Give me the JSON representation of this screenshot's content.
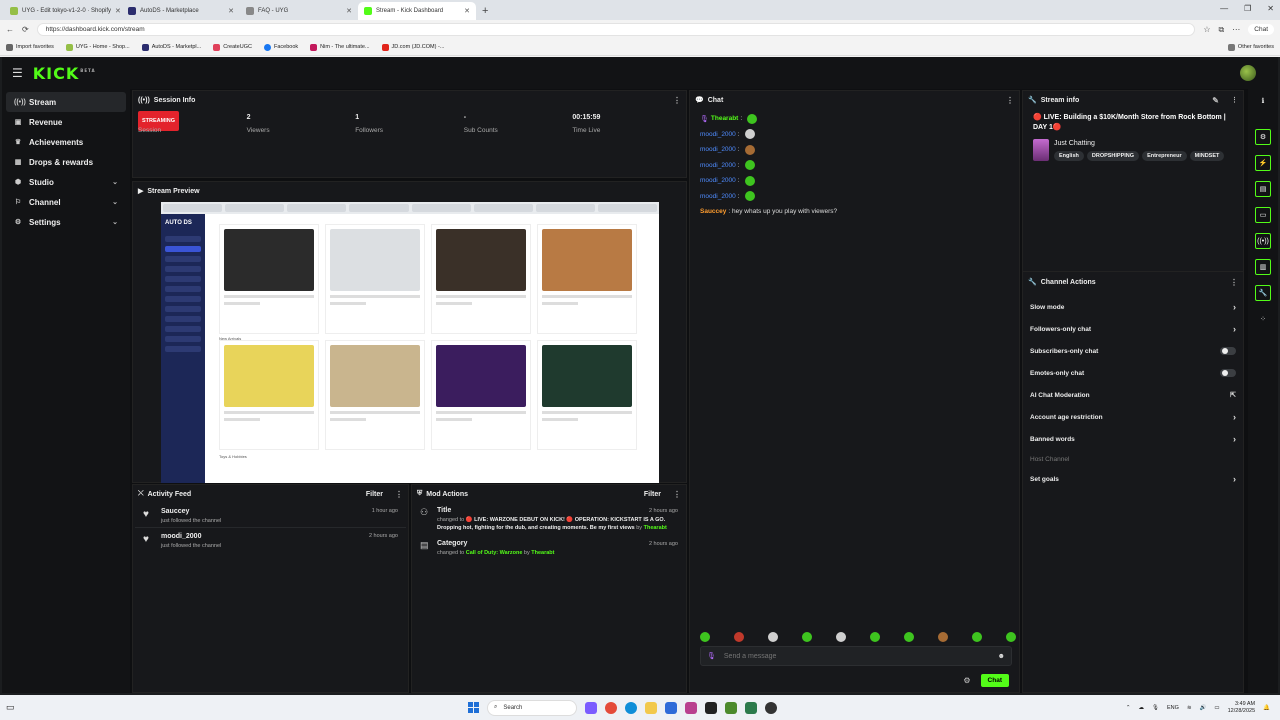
{
  "browser": {
    "tabs": [
      {
        "label": "UYG - Edit tokyo-v1-2-0 · Shopify",
        "color": "#95bf47"
      },
      {
        "label": "AutoDS - Marketplace",
        "color": "#2b2d6e"
      },
      {
        "label": "FAQ - UYG",
        "color": "#888888"
      },
      {
        "label": "Stream - Kick Dashboard",
        "color": "#53fc18"
      }
    ],
    "url": "https://dashboard.kick.com/stream",
    "chat_label": "Chat",
    "bookmarks": [
      {
        "label": "Import favorites",
        "color": "#666666"
      },
      {
        "label": "UYG - Home - Shop...",
        "color": "#95bf47"
      },
      {
        "label": "AutoDS - Marketpl...",
        "color": "#2b2d6e"
      },
      {
        "label": "CreateUGC",
        "color": "#e0405a"
      },
      {
        "label": "Facebook",
        "color": "#1877f2"
      },
      {
        "label": "Nim - The ultimate...",
        "color": "#c2185b"
      },
      {
        "label": "JD.com (JD.COM) -...",
        "color": "#e1251b"
      }
    ],
    "other_favorites": "Other favorites"
  },
  "app": {
    "logo": "KICK",
    "logo_sup": "BETA",
    "accent": "#53fc18"
  },
  "sidebar": {
    "items": [
      {
        "label": "Stream",
        "icon": "broadcast-icon"
      },
      {
        "label": "Revenue",
        "icon": "wallet-icon"
      },
      {
        "label": "Achievements",
        "icon": "trophy-icon"
      },
      {
        "label": "Drops & rewards",
        "icon": "gift-icon"
      },
      {
        "label": "Studio",
        "icon": "studio-icon"
      },
      {
        "label": "Channel",
        "icon": "channel-icon"
      },
      {
        "label": "Settings",
        "icon": "gear-icon"
      }
    ]
  },
  "session": {
    "title": "Session Info",
    "badge": "STREAMING",
    "badge_label": "Session",
    "viewers_value": "2",
    "viewers_label": "Viewers",
    "followers_value": "1",
    "followers_label": "Followers",
    "subs_value": "-",
    "subs_label": "Sub Counts",
    "time_value": "00:15:59",
    "time_label": "Time Live"
  },
  "preview": {
    "title": "Stream Preview",
    "brand": "AUTO DS",
    "section1": "New Arrivals",
    "section2": "Toys & Hobbies"
  },
  "activity": {
    "title": "Activity Feed",
    "filter": "Filter",
    "items": [
      {
        "name": "Sauccey",
        "sub": "just followed the channel",
        "time": "1 hour ago"
      },
      {
        "name": "moodi_2000",
        "sub": "just followed the channel",
        "time": "2 hours ago"
      }
    ]
  },
  "mod": {
    "title": "Mod Actions",
    "filter": "Filter",
    "items": [
      {
        "title": "Title",
        "time": "2 hours ago",
        "pre": "changed to",
        "value": "🔴 LIVE: WARZONE DEBUT ON KICK! 🔴 OPERATION: KICKSTART IS A GO. Dropping hot, fighting for the dub, and creating moments. Be my first views",
        "by": "by",
        "user": "Thearabt"
      },
      {
        "title": "Category",
        "time": "2 hours ago",
        "pre": "changed to",
        "value": "Call of Duty: Warzone",
        "by": "by",
        "user": "Thearabt"
      }
    ]
  },
  "chat": {
    "title": "Chat",
    "messages": [
      {
        "user": "Thearabt",
        "style": "g",
        "text": ":",
        "emote": "",
        "mic": true
      },
      {
        "user": "moodi_2000",
        "style": "",
        "text": ":",
        "emote": "w"
      },
      {
        "user": "moodi_2000",
        "style": "",
        "text": ":",
        "emote": "b"
      },
      {
        "user": "moodi_2000",
        "style": "",
        "text": ":",
        "emote": ""
      },
      {
        "user": "moodi_2000",
        "style": "",
        "text": ":",
        "emote": ""
      },
      {
        "user": "moodi_2000",
        "style": "",
        "text": ":",
        "emote": ""
      },
      {
        "user": "Sauccey",
        "style": "o",
        "text": ": hey whats up you play with viewers?",
        "emote": "none"
      }
    ],
    "placeholder": "Send a message",
    "send": "Chat"
  },
  "stream_info": {
    "title": "Stream info",
    "stream_title": "🔴 LIVE: Building a $10K/Month Store from Rock Bottom | DAY 1🔴",
    "category": "Just Chatting",
    "tags": [
      "English",
      "DROPSHIPPING",
      "Entrepreneur",
      "MINDSET"
    ]
  },
  "actions": {
    "title": "Channel Actions",
    "items": [
      {
        "label": "Slow mode",
        "kind": "chevron"
      },
      {
        "label": "Followers-only chat",
        "kind": "chevron"
      },
      {
        "label": "Subscribers-only chat",
        "kind": "toggle"
      },
      {
        "label": "Emotes-only chat",
        "kind": "toggle"
      },
      {
        "label": "AI Chat Moderation",
        "kind": "external"
      },
      {
        "label": "Account age restriction",
        "kind": "chevron"
      },
      {
        "label": "Banned words",
        "kind": "chevron"
      },
      {
        "label": "Host Channel",
        "kind": "dim"
      },
      {
        "label": "Set goals",
        "kind": "chevron"
      }
    ]
  },
  "taskbar": {
    "search": "Search",
    "lang": "ENG",
    "time": "3:49 AM",
    "date": "12/28/2025"
  }
}
